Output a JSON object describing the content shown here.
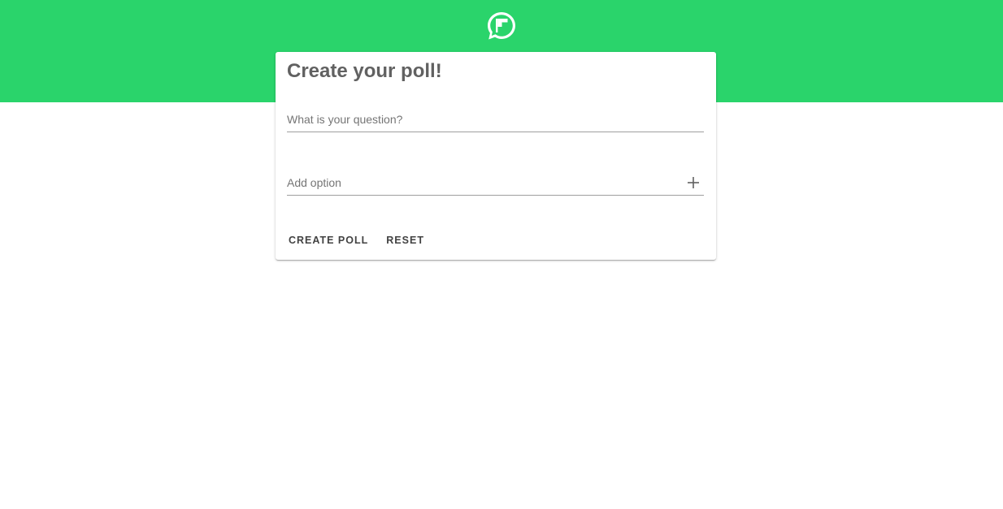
{
  "app": {
    "logo_icon": "chat-flag-icon",
    "brand_color": "#2ad46b"
  },
  "poll_form": {
    "title": "Create your poll!",
    "question_input": {
      "placeholder": "What is your question?",
      "value": ""
    },
    "option_input": {
      "placeholder": "Add option",
      "value": "",
      "add_icon": "plus-icon"
    },
    "actions": {
      "create_label": "CREATE POLL",
      "reset_label": "RESET"
    }
  }
}
